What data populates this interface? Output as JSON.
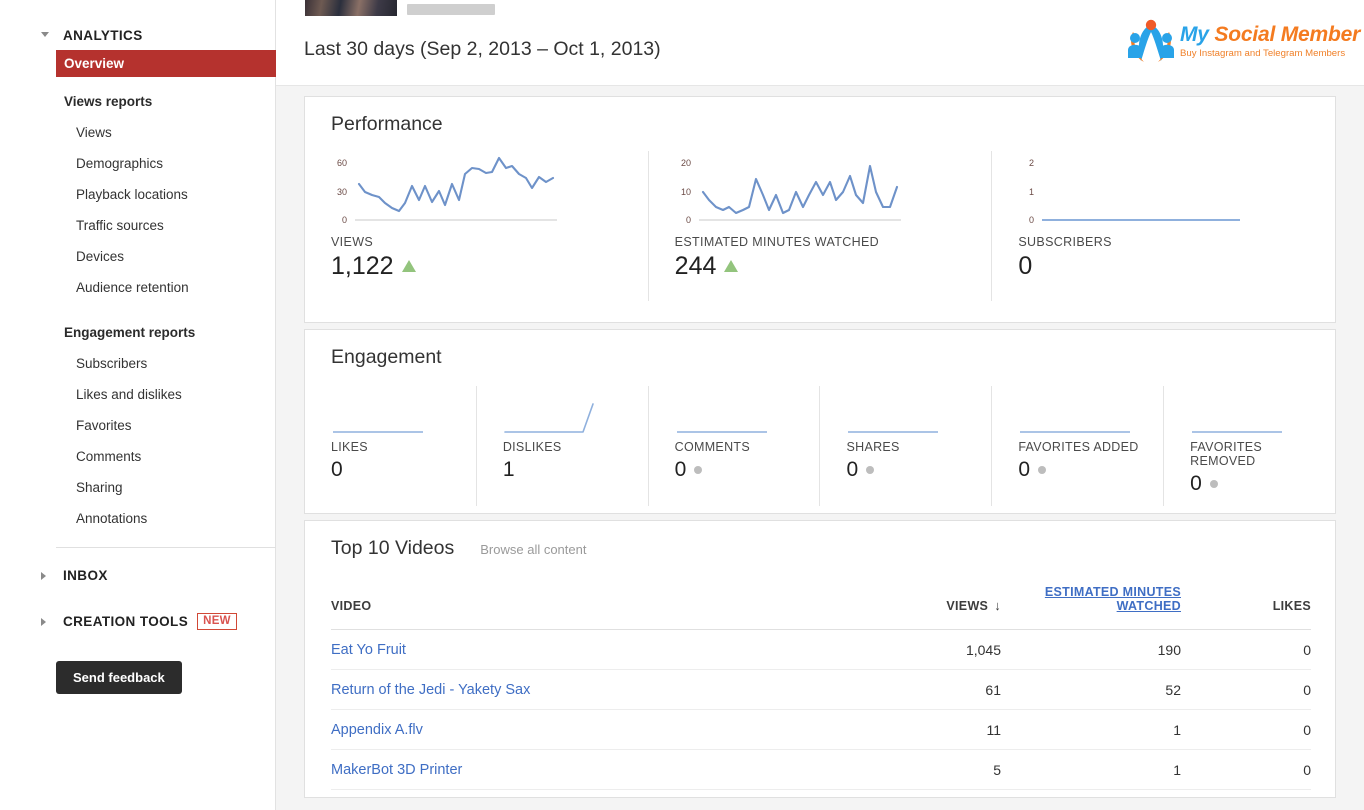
{
  "sidebar": {
    "analytics": {
      "title": "ANALYTICS",
      "selected_item": "Overview",
      "groups": [
        {
          "label": "Views reports",
          "items": [
            "Views",
            "Demographics",
            "Playback locations",
            "Traffic sources",
            "Devices",
            "Audience retention"
          ]
        },
        {
          "label": "Engagement reports",
          "items": [
            "Subscribers",
            "Likes and dislikes",
            "Favorites",
            "Comments",
            "Sharing",
            "Annotations"
          ]
        }
      ]
    },
    "inbox": {
      "title": "INBOX"
    },
    "creation_tools": {
      "title": "CREATION TOOLS",
      "badge": "NEW"
    },
    "feedback_button": "Send feedback"
  },
  "header": {
    "date_range": "Last 30 days (Sep 2, 2013 – Oct 1, 2013)"
  },
  "watermark": {
    "title_part1": "My ",
    "title_part2": "Social ",
    "title_part3": "Member",
    "tagline": "Buy Instagram and Telegram Members",
    "blue": "#29a3e8",
    "orange": "#f47b20"
  },
  "performance": {
    "title": "Performance",
    "metrics": [
      {
        "label": "VIEWS",
        "value": "1,122",
        "trend": "up"
      },
      {
        "label": "ESTIMATED MINUTES WATCHED",
        "value": "244",
        "trend": "up"
      },
      {
        "label": "SUBSCRIBERS",
        "value": "0",
        "trend": "none"
      }
    ]
  },
  "engagement": {
    "title": "Engagement",
    "metrics": [
      {
        "label": "LIKES",
        "value": "0",
        "trend": "none",
        "dot": false
      },
      {
        "label": "DISLIKES",
        "value": "1",
        "trend": "none",
        "dot": false
      },
      {
        "label": "COMMENTS",
        "value": "0",
        "trend": "none",
        "dot": true
      },
      {
        "label": "SHARES",
        "value": "0",
        "trend": "none",
        "dot": true
      },
      {
        "label": "FAVORITES ADDED",
        "value": "0",
        "trend": "none",
        "dot": true
      },
      {
        "label": "FAVORITES REMOVED",
        "value": "0",
        "trend": "none",
        "dot": true
      }
    ]
  },
  "videos": {
    "title": "Top 10 Videos",
    "browse_link": "Browse all content",
    "columns": {
      "video": "VIDEO",
      "views": "VIEWS",
      "views_sort": "↓",
      "estimated_minutes_watched": "ESTIMATED MINUTES WATCHED",
      "likes": "LIKES"
    },
    "rows": [
      {
        "video": "Eat Yo Fruit",
        "views": "1,045",
        "emw": "190",
        "likes": "0"
      },
      {
        "video": "Return of the Jedi - Yakety Sax",
        "views": "61",
        "emw": "52",
        "likes": "0"
      },
      {
        "video": "Appendix A.flv",
        "views": "11",
        "emw": "1",
        "likes": "0"
      },
      {
        "video": "MakerBot 3D Printer",
        "views": "5",
        "emw": "1",
        "likes": "0"
      }
    ]
  },
  "chart_data": [
    {
      "type": "line",
      "title": "VIEWS",
      "ylabel": "",
      "xlabel": "",
      "yticks": [
        0,
        30,
        60
      ],
      "ylim": [
        0,
        66
      ],
      "grid": false,
      "total": 1122,
      "values": [
        39,
        33,
        31,
        30,
        26,
        22,
        20,
        25,
        36,
        27,
        36,
        25,
        33,
        24,
        37,
        26,
        44,
        50,
        49,
        46,
        47,
        59,
        50,
        52,
        44,
        41,
        34,
        42,
        38,
        42
      ]
    },
    {
      "type": "line",
      "title": "ESTIMATED MINUTES WATCHED",
      "ylabel": "",
      "xlabel": "",
      "yticks": [
        0,
        10,
        20
      ],
      "ylim": [
        0,
        22
      ],
      "grid": false,
      "total": 244,
      "values": [
        10,
        8,
        6,
        5,
        6,
        4,
        5,
        6,
        14,
        9,
        5,
        9,
        4,
        5,
        10,
        6,
        9,
        13,
        9,
        13,
        8,
        10,
        15,
        9,
        7,
        18,
        10,
        6,
        6,
        12
      ]
    },
    {
      "type": "line",
      "title": "SUBSCRIBERS",
      "ylabel": "",
      "xlabel": "",
      "yticks": [
        0,
        1,
        2
      ],
      "ylim": [
        0,
        2
      ],
      "grid": false,
      "total": 0,
      "values": [
        0,
        0,
        0,
        0,
        0,
        0,
        0,
        0,
        0,
        0,
        0,
        0,
        0,
        0,
        0,
        0,
        0,
        0,
        0,
        0,
        0,
        0,
        0,
        0,
        0,
        0,
        0,
        0,
        0,
        0
      ]
    },
    {
      "type": "line",
      "title": "LIKES",
      "total": 0,
      "values": [
        0,
        0,
        0,
        0,
        0,
        0,
        0,
        0,
        0,
        0,
        0,
        0,
        0,
        0,
        0,
        0,
        0,
        0,
        0,
        0,
        0,
        0,
        0,
        0,
        0,
        0,
        0,
        0,
        0,
        0
      ]
    },
    {
      "type": "line",
      "title": "DISLIKES",
      "total": 1,
      "values": [
        0,
        0,
        0,
        0,
        0,
        0,
        0,
        0,
        0,
        0,
        0,
        0,
        0,
        0,
        0,
        0,
        0,
        0,
        0,
        0,
        0,
        0,
        0,
        0,
        0,
        0,
        0,
        0,
        0,
        1
      ]
    },
    {
      "type": "line",
      "title": "COMMENTS",
      "total": 0,
      "values": [
        0,
        0,
        0,
        0,
        0,
        0,
        0,
        0,
        0,
        0,
        0,
        0,
        0,
        0,
        0,
        0,
        0,
        0,
        0,
        0,
        0,
        0,
        0,
        0,
        0,
        0,
        0,
        0,
        0,
        0
      ]
    },
    {
      "type": "line",
      "title": "SHARES",
      "total": 0,
      "values": [
        0,
        0,
        0,
        0,
        0,
        0,
        0,
        0,
        0,
        0,
        0,
        0,
        0,
        0,
        0,
        0,
        0,
        0,
        0,
        0,
        0,
        0,
        0,
        0,
        0,
        0,
        0,
        0,
        0,
        0
      ]
    },
    {
      "type": "line",
      "title": "FAVORITES ADDED",
      "total": 0,
      "values": [
        0,
        0,
        0,
        0,
        0,
        0,
        0,
        0,
        0,
        0,
        0,
        0,
        0,
        0,
        0,
        0,
        0,
        0,
        0,
        0,
        0,
        0,
        0,
        0,
        0,
        0,
        0,
        0,
        0,
        0
      ]
    },
    {
      "type": "line",
      "title": "FAVORITES REMOVED",
      "total": 0,
      "values": [
        0,
        0,
        0,
        0,
        0,
        0,
        0,
        0,
        0,
        0,
        0,
        0,
        0,
        0,
        0,
        0,
        0,
        0,
        0,
        0,
        0,
        0,
        0,
        0,
        0,
        0,
        0,
        0,
        0,
        0
      ]
    }
  ]
}
